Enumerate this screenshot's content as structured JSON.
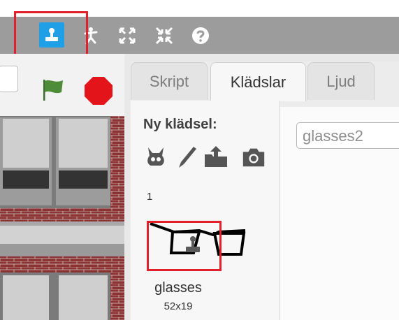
{
  "toolbar": {
    "icons": [
      "stamp-icon",
      "cut-icon",
      "grow-icon",
      "shrink-icon",
      "help-icon"
    ],
    "highlight_color": "#e0202a",
    "active_color": "#1fa0e6"
  },
  "stage": {
    "controls": [
      "green-flag-icon",
      "stop-icon"
    ]
  },
  "tabs": {
    "script": "Skript",
    "costumes": "Klädslar",
    "sounds": "Ljud"
  },
  "costumes_panel": {
    "new_costume_label": "Ny klädsel:",
    "new_costume_icons": [
      "choose-costume-icon",
      "paint-icon",
      "upload-icon",
      "camera-icon"
    ],
    "items": [
      {
        "index": "1",
        "name": "glasses",
        "size": "52x19"
      }
    ]
  },
  "editor": {
    "costume_name_value": "glasses2"
  }
}
